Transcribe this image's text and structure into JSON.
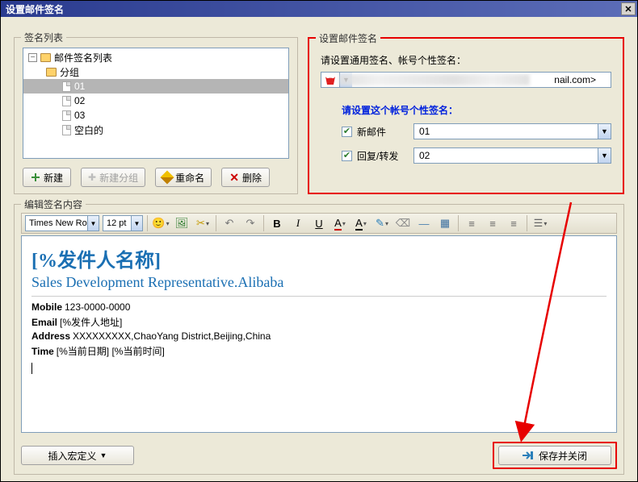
{
  "window": {
    "title": "设置邮件签名"
  },
  "groups": {
    "list_label": "签名列表",
    "set_label": "设置邮件签名",
    "edit_label": "编辑签名内容"
  },
  "tree": {
    "root": "邮件签名列表",
    "group": "分组",
    "items": [
      "01",
      "02",
      "03",
      "空白的"
    ],
    "selected_index": 0
  },
  "buttons": {
    "new_": "新建",
    "new_group": "新建分组",
    "rename": "重命名",
    "delete": "删除",
    "insert_macro": "插入宏定义",
    "save_close": "保存并关闭"
  },
  "set_panel": {
    "prompt": "请设置通用签名、帐号个性签名：",
    "account_tail": "nail.com>",
    "sub_prompt": "请设置这个帐号个性签名：",
    "new_mail_label": "新邮件",
    "reply_label": "回复/转发",
    "new_mail_value": "01",
    "reply_value": "02",
    "new_mail_checked": true,
    "reply_checked": true
  },
  "toolbar": {
    "font": "Times New Ro",
    "size": "12 pt"
  },
  "signature": {
    "name_line": "[%发件人名称]",
    "title_line": "Sales Development Representative.Alibaba",
    "mobile_label": "Mobile",
    "mobile_value": "123-0000-0000",
    "email_label": "Email",
    "email_value": "[%发件人地址]",
    "address_label": "Address",
    "address_value": "XXXXXXXXX,ChaoYang District,Beijing,China",
    "time_label": "Time",
    "time_value": "[%当前日期] [%当前时间]"
  }
}
